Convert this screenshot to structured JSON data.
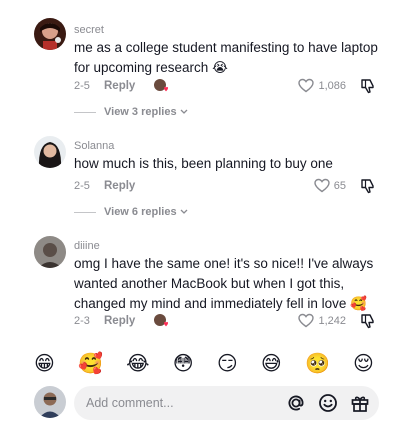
{
  "comments": [
    {
      "username": "secret",
      "text": "me as a college student manifesting to have laptop for upcoming research",
      "text_emoji": "😭",
      "date": "2-5",
      "reply_label": "Reply",
      "likes": "1,086",
      "view_replies": "View 3 replies"
    },
    {
      "username": "Solanna",
      "text": "how much is this, been planning to buy one",
      "date": "2-5",
      "reply_label": "Reply",
      "likes": "65",
      "view_replies": "View 6 replies"
    },
    {
      "username": "diiine",
      "text": "omg I have the same one! it's so nice!! I've always wanted another MacBook but when I got this, changed my mind and immediately fell in love",
      "text_emoji": "🥰",
      "date": "2-3",
      "reply_label": "Reply",
      "likes": "1,242"
    }
  ],
  "emoji_bar": [
    "😁",
    "🥰",
    "😂",
    "😳",
    "😏",
    "😅",
    "🥺",
    "😌"
  ],
  "composer": {
    "placeholder": "Add comment..."
  },
  "colors": {
    "text": "#161823",
    "muted": "#8a8b91",
    "input_bg": "#f1f1f2",
    "creator_heart": "#fe2c55"
  }
}
